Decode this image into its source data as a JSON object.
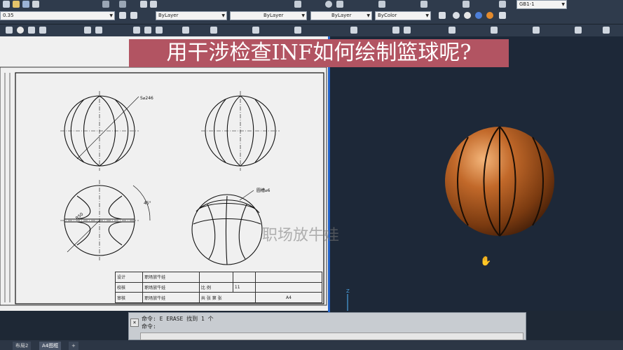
{
  "toolbar": {
    "width_value": "0.35",
    "layer_color": "ByLayer",
    "linetype": "ByLayer",
    "lineweight": "ByLayer",
    "plot_style": "ByColor",
    "style_name": "GB1-1"
  },
  "banner": {
    "title": "用干涉检查INF如何绘制篮球呢?"
  },
  "drawing": {
    "label_radius": "S⌀246",
    "label_angle": "45°",
    "label_width": "R50",
    "label_groove": "圆槽⌀6"
  },
  "title_block": {
    "design_label": "设计",
    "check_label": "校核",
    "review_label": "审核",
    "design_name": "职场放牛娃",
    "check_name": "职场放牛娃",
    "review_name": "职场放牛娃",
    "scale_label": "比 例",
    "scale_value": "11",
    "sheets_text": "共 张 第 张",
    "sheet_size": "A4"
  },
  "watermark": "职场放牛娃",
  "command": {
    "line1": "命令: E ERASE 找到 1 个",
    "line2": "命令:"
  },
  "tabs": [
    "布局2",
    "A4图框",
    "+"
  ],
  "colors": {
    "banner": "#b25462",
    "divider": "#2262c8",
    "ball_main": "#b5651d"
  }
}
